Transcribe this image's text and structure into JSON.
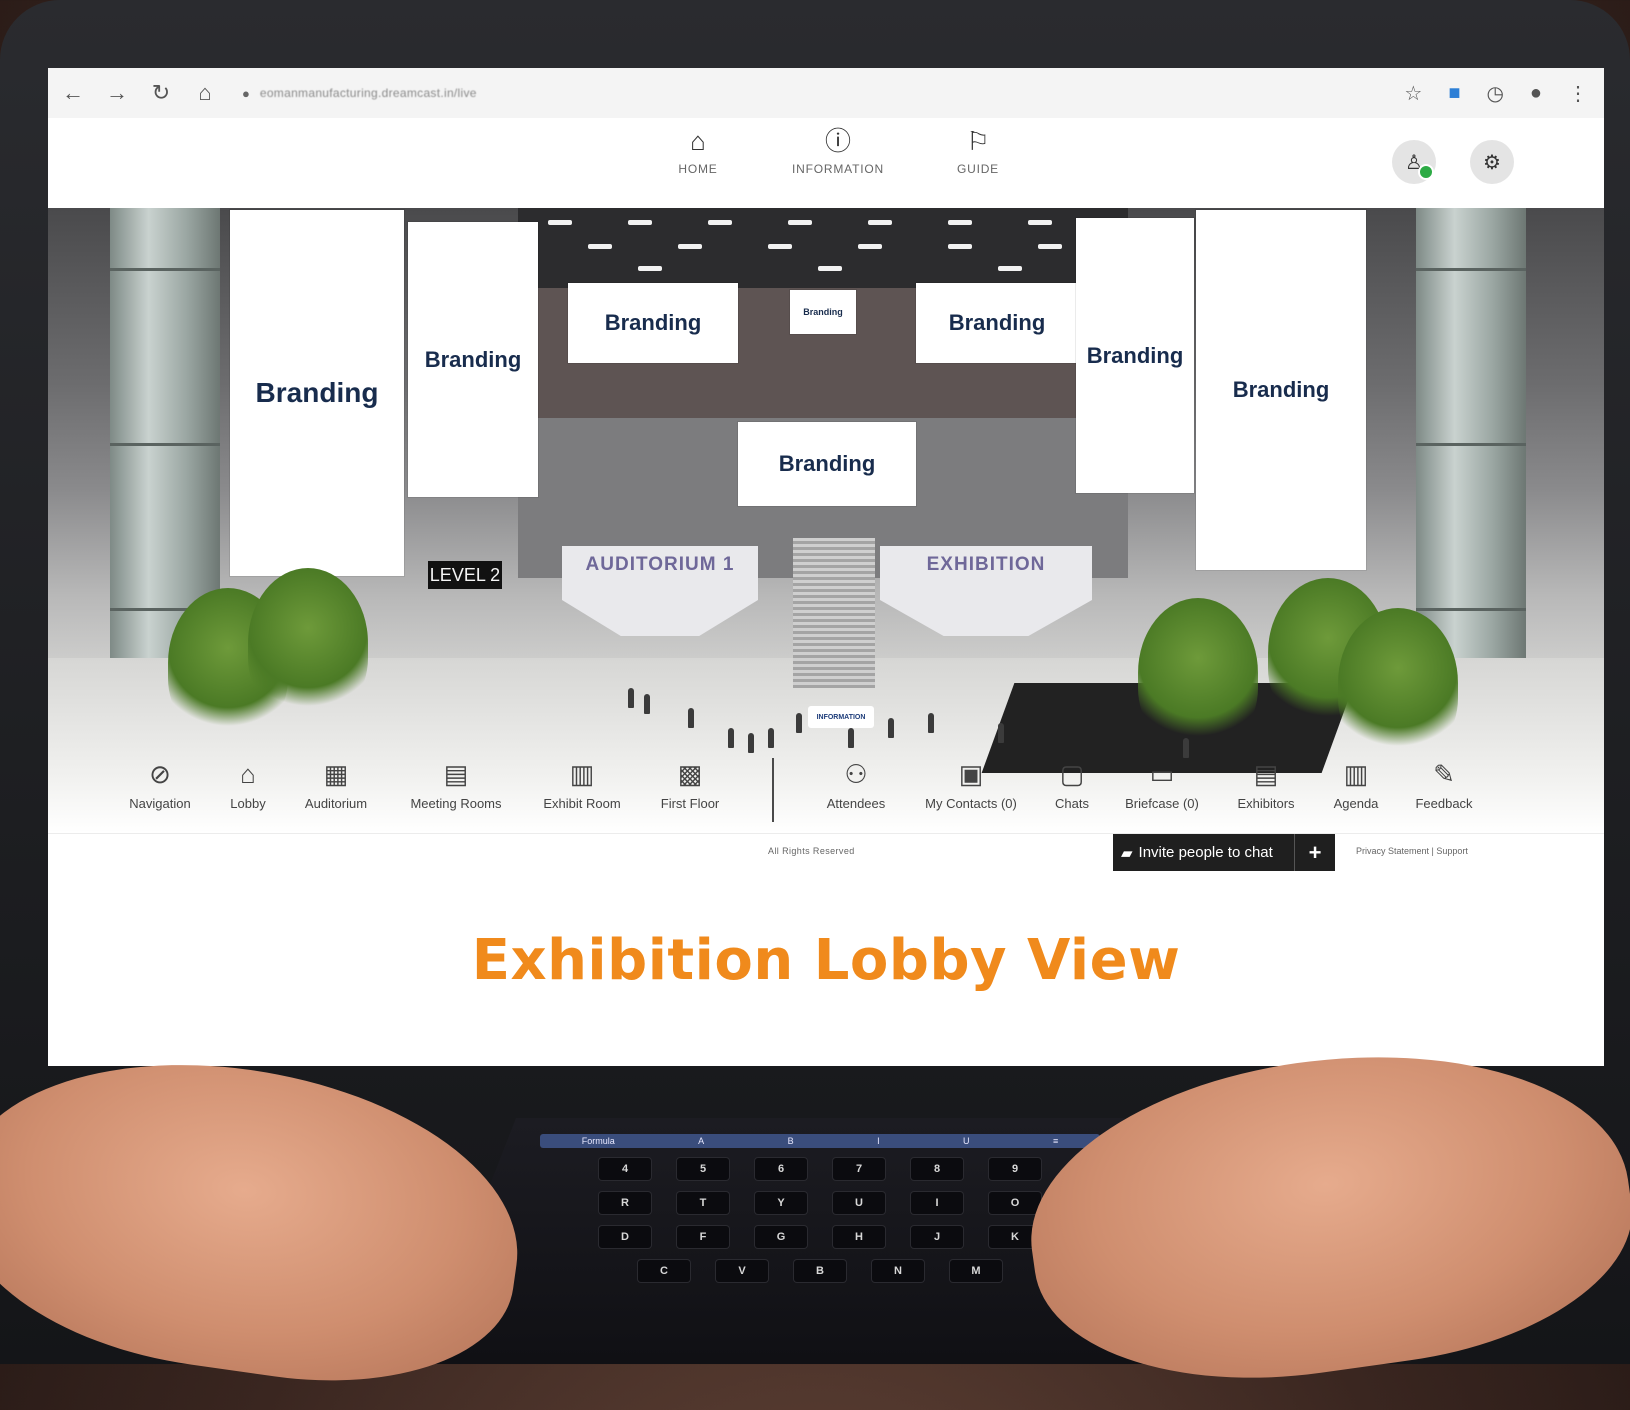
{
  "browser": {
    "url": "eomanmanufacturing.dreamcast.in/live",
    "nav_icons": [
      "back-icon",
      "forward-icon",
      "reload-icon",
      "home-icon"
    ],
    "right_icons": [
      "star-icon",
      "windows-icon",
      "clock-icon",
      "profile-icon",
      "menu-icon"
    ]
  },
  "topnav": {
    "items": [
      {
        "label": "HOME",
        "icon": "home-icon"
      },
      {
        "label": "INFORMATION",
        "icon": "info-icon"
      },
      {
        "label": "GUIDE",
        "icon": "signpost-icon"
      }
    ]
  },
  "scene": {
    "banners": [
      "Branding",
      "Branding",
      "Branding",
      "Branding",
      "Branding",
      "Branding",
      "Branding",
      "Branding",
      "Branding"
    ],
    "level_sign": "LEVEL 2",
    "auditorium_sign": "AUDITORIUM 1",
    "exhibition_sign": "EXHIBITION",
    "info_desk": "INFORMATION"
  },
  "toolbar": {
    "items": [
      {
        "label": "Navigation",
        "icon": "compass-icon",
        "glyph": "⊘"
      },
      {
        "label": "Lobby",
        "icon": "home-icon",
        "glyph": "⌂"
      },
      {
        "label": "Auditorium",
        "icon": "auditorium-icon",
        "glyph": "▦"
      },
      {
        "label": "Meeting Rooms",
        "icon": "meeting-icon",
        "glyph": "▤"
      },
      {
        "label": "Exhibit Room",
        "icon": "exhibit-icon",
        "glyph": "▥"
      },
      {
        "label": "First Floor",
        "icon": "building-icon",
        "glyph": "▩"
      },
      {
        "label": "Attendees",
        "icon": "people-icon",
        "glyph": "⚇"
      },
      {
        "label": "My Contacts (0)",
        "icon": "contacts-icon",
        "glyph": "▣"
      },
      {
        "label": "Chats",
        "icon": "chat-icon",
        "glyph": "▢"
      },
      {
        "label": "Briefcase (0)",
        "icon": "folder-icon",
        "glyph": "▭"
      },
      {
        "label": "Exhibitors",
        "icon": "id-card-icon",
        "glyph": "▤"
      },
      {
        "label": "Agenda",
        "icon": "clipboard-icon",
        "glyph": "▥"
      },
      {
        "label": "Feedback",
        "icon": "feedback-icon",
        "glyph": "✎"
      }
    ]
  },
  "footer": {
    "rights": "All Rights Reserved",
    "invite_label": "Invite people to chat",
    "invite_plus": "+",
    "links": "Privacy Statement | Support"
  },
  "caption": "Exhibition Lobby View",
  "keyboard": {
    "touchbar": [
      "Formula",
      "A",
      "B",
      "I",
      "U",
      "≡"
    ],
    "rows": [
      [
        "4",
        "5",
        "6",
        "7",
        "8",
        "9"
      ],
      [
        "R",
        "T",
        "Y",
        "U",
        "I",
        "O"
      ],
      [
        "D",
        "F",
        "G",
        "H",
        "J",
        "K"
      ],
      [
        "C",
        "V",
        "B",
        "N",
        "M"
      ]
    ]
  },
  "colors": {
    "caption": "#f08a1c",
    "banner_text": "#182c4d",
    "invite_bg": "#1f1f1f",
    "online_dot": "#2dab45"
  }
}
